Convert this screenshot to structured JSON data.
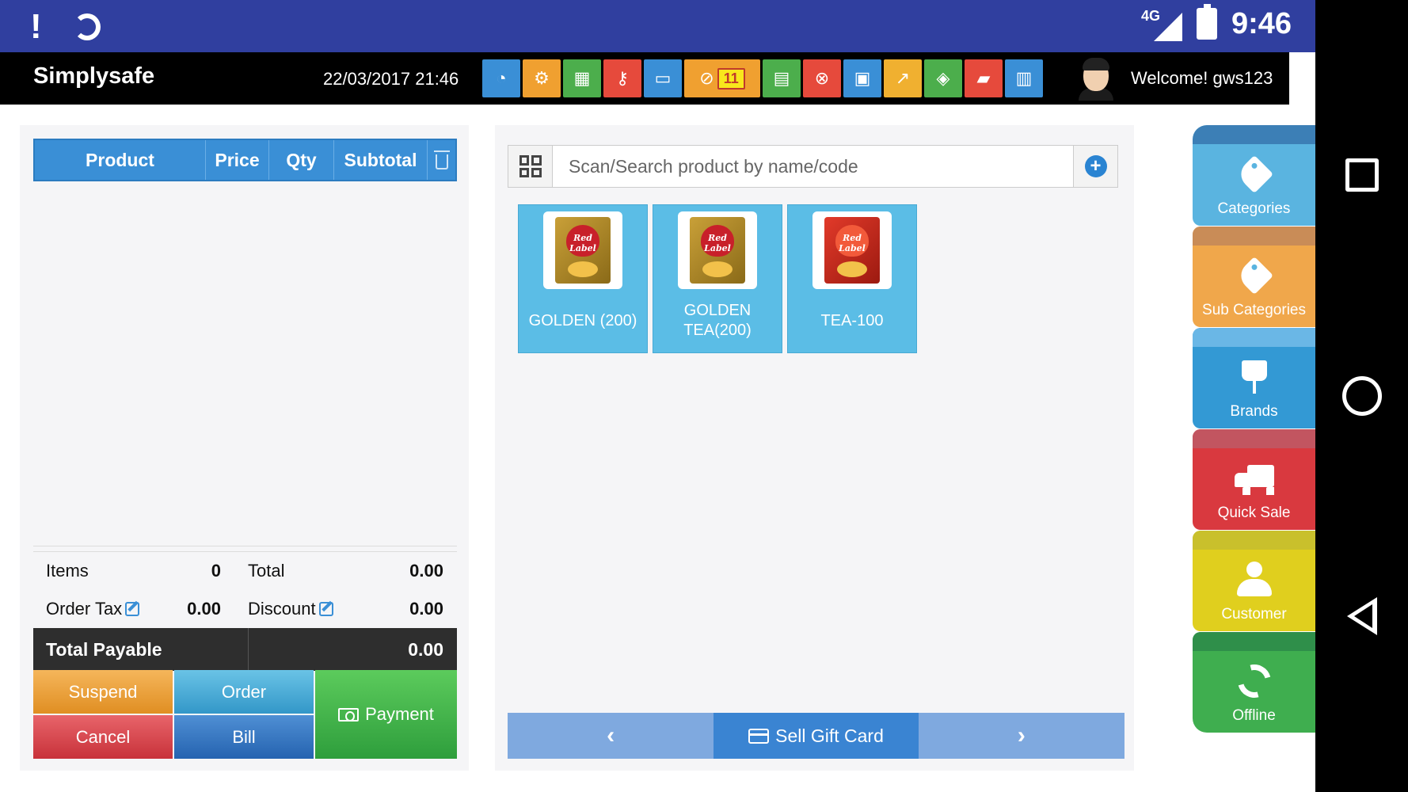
{
  "statusbar": {
    "network": "4G",
    "time": "9:46"
  },
  "header": {
    "brand": "Simplysafe",
    "datetime": "22/03/2017 21:46",
    "welcome": "Welcome! gws123",
    "toolbar": [
      {
        "icon": "dashboard-icon",
        "color": "#3a8fd6"
      },
      {
        "icon": "settings-icon",
        "color": "#f0a030"
      },
      {
        "icon": "calculator-icon",
        "color": "#4cae4c"
      },
      {
        "icon": "key-icon",
        "color": "#e64a3c"
      },
      {
        "icon": "laptop-icon",
        "color": "#3a8fd6"
      },
      {
        "icon": "no-sign-icon",
        "color": "#f0a030",
        "badge": "11"
      },
      {
        "icon": "document-icon",
        "color": "#4cae4c"
      },
      {
        "icon": "close-circle-icon",
        "color": "#e64a3c"
      },
      {
        "icon": "money-icon",
        "color": "#3a8fd6"
      },
      {
        "icon": "chart-icon",
        "color": "#f0b030"
      },
      {
        "icon": "tags-icon",
        "color": "#4cae4c"
      },
      {
        "icon": "eraser-icon",
        "color": "#e64a3c"
      },
      {
        "icon": "trash-icon",
        "color": "#3a8fd6"
      }
    ]
  },
  "cart": {
    "columns": {
      "product": "Product",
      "price": "Price",
      "qty": "Qty",
      "subtotal": "Subtotal"
    },
    "items_label": "Items",
    "items_value": "0",
    "total_label": "Total",
    "total_value": "0.00",
    "order_tax_label": "Order Tax",
    "order_tax_value": "0.00",
    "discount_label": "Discount",
    "discount_value": "0.00",
    "total_payable_label": "Total Payable",
    "total_payable_value": "0.00"
  },
  "actions": {
    "suspend": "Suspend",
    "order": "Order",
    "payment": "Payment",
    "cancel": "Cancel",
    "bill": "Bill"
  },
  "search": {
    "placeholder": "Scan/Search product by name/code"
  },
  "products": [
    {
      "name": "GOLDEN (200)",
      "pack": "gold"
    },
    {
      "name": "GOLDEN TEA(200)",
      "pack": "gold"
    },
    {
      "name": "TEA-100",
      "pack": "red"
    }
  ],
  "pager": {
    "prev": "‹",
    "gift": "Sell Gift Card",
    "next": "›"
  },
  "sidebar": {
    "categories": "Categories",
    "sub_categories": "Sub Categories",
    "brands": "Brands",
    "quick_sale": "Quick Sale",
    "customer": "Customer",
    "offline": "Offline"
  }
}
